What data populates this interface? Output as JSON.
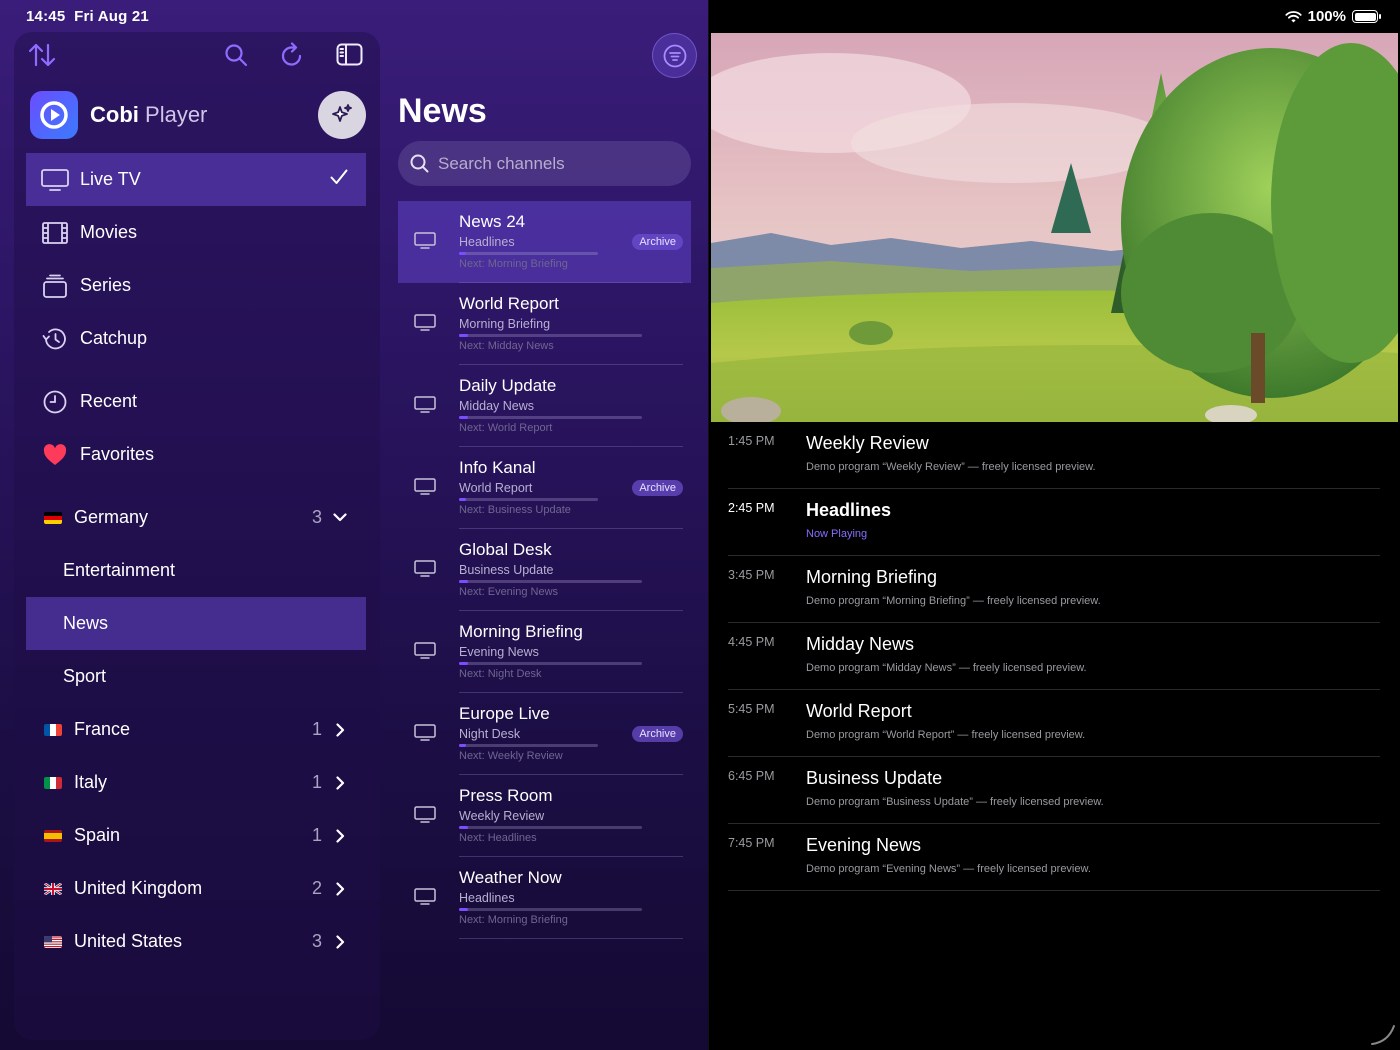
{
  "status": {
    "time": "14:45",
    "date": "Fri Aug 21",
    "battery": "100%"
  },
  "brand": {
    "name_bold": "Cobi",
    "name_light": "Player"
  },
  "sidebar": {
    "main": [
      {
        "label": "Live TV",
        "icon": "tv-icon",
        "active": true
      },
      {
        "label": "Movies",
        "icon": "film-icon"
      },
      {
        "label": "Series",
        "icon": "series-stack-icon"
      },
      {
        "label": "Catchup",
        "icon": "history-clock-icon"
      }
    ],
    "library": [
      {
        "label": "Recent",
        "icon": "clock-icon"
      },
      {
        "label": "Favorites",
        "icon": "heart-icon"
      }
    ],
    "countries": [
      {
        "label": "Germany",
        "count": "3",
        "expanded": true,
        "flag": [
          "#000000",
          "#dd0000",
          "#ffce00"
        ]
      },
      {
        "label": "France",
        "count": "1",
        "flag": [
          "#0055a4",
          "#ffffff",
          "#ef4135"
        ],
        "vertical": true
      },
      {
        "label": "Italy",
        "count": "1",
        "flag": [
          "#009246",
          "#ffffff",
          "#ce2b37"
        ],
        "vertical": true
      },
      {
        "label": "Spain",
        "count": "1",
        "flag": [
          "#aa151b",
          "#f1bf00",
          "#aa151b"
        ]
      },
      {
        "label": "United Kingdom",
        "count": "2",
        "flag": [
          "#012169",
          "#c8102e",
          "#012169"
        ]
      },
      {
        "label": "United States",
        "count": "3",
        "flag": [
          "#b22234",
          "#ffffff",
          "#3c3b6e"
        ]
      }
    ],
    "germany_groups": [
      {
        "label": "Entertainment"
      },
      {
        "label": "News",
        "active": true
      },
      {
        "label": "Sport"
      }
    ]
  },
  "channel_list": {
    "title": "News",
    "search_placeholder": "Search channels",
    "channels": [
      {
        "name": "News 24",
        "program": "Headlines",
        "next": "Next: Morning Briefing",
        "progress": 0.05,
        "badge": "Archive",
        "selected": true
      },
      {
        "name": "World Report",
        "program": "Morning Briefing",
        "next": "Next: Midday News",
        "progress": 0.05
      },
      {
        "name": "Daily Update",
        "program": "Midday News",
        "next": "Next: World Report",
        "progress": 0.05
      },
      {
        "name": "Info Kanal",
        "program": "World Report",
        "next": "Next: Business Update",
        "progress": 0.05,
        "badge": "Archive"
      },
      {
        "name": "Global Desk",
        "program": "Business Update",
        "next": "Next: Evening News",
        "progress": 0.05
      },
      {
        "name": "Morning Briefing",
        "program": "Evening News",
        "next": "Next: Night Desk",
        "progress": 0.05
      },
      {
        "name": "Europe Live",
        "program": "Night Desk",
        "next": "Next: Weekly Review",
        "progress": 0.05,
        "badge": "Archive"
      },
      {
        "name": "Press Room",
        "program": "Weekly Review",
        "next": "Next: Headlines",
        "progress": 0.05
      },
      {
        "name": "Weather Now",
        "program": "Headlines",
        "next": "Next: Morning Briefing",
        "progress": 0.05
      }
    ]
  },
  "guide": [
    {
      "time": "1:45 PM",
      "title": "Weekly Review",
      "desc": "Demo program “Weekly Review” — freely licensed preview."
    },
    {
      "time": "2:45 PM",
      "title": "Headlines",
      "desc": "Now Playing",
      "now": true
    },
    {
      "time": "3:45 PM",
      "title": "Morning Briefing",
      "desc": "Demo program “Morning Briefing” — freely licensed preview."
    },
    {
      "time": "4:45 PM",
      "title": "Midday News",
      "desc": "Demo program “Midday News” — freely licensed preview."
    },
    {
      "time": "5:45 PM",
      "title": "World Report",
      "desc": "Demo program “World Report” — freely licensed preview."
    },
    {
      "time": "6:45 PM",
      "title": "Business Update",
      "desc": "Demo program “Business Update” — freely licensed preview."
    },
    {
      "time": "7:45 PM",
      "title": "Evening News",
      "desc": "Demo program “Evening News” — freely licensed preview."
    }
  ],
  "colors": {
    "accent": "#8f6cff",
    "active_row": "#5a3fb8",
    "now_playing": "#8a6cff"
  }
}
